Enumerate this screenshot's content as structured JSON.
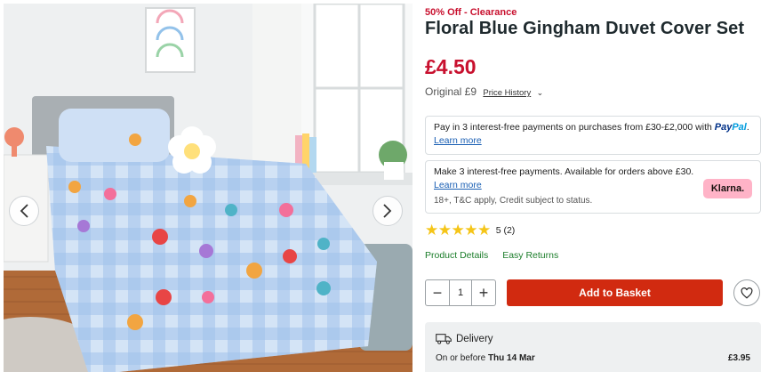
{
  "product": {
    "promo": "50% Off - Clearance",
    "title": "Floral Blue Gingham Duvet Cover Set",
    "price": "£4.50",
    "original_label": "Original £9",
    "price_history_label": "Price History",
    "rating_stars": 5,
    "rating_text": "5 (2)"
  },
  "gallery": {
    "prev_icon": "chevron-left-icon",
    "next_icon": "chevron-right-icon"
  },
  "paypal": {
    "text": "Pay in 3 interest-free payments on purchases from £30-£2,000 with",
    "logo_part1": "Pay",
    "logo_part2": "Pal",
    "logo_suffix": ".",
    "link": "Learn more"
  },
  "klarna": {
    "text": "Make 3 interest-free payments. Available for orders above £30.",
    "link": "Learn more",
    "note": "18+, T&C apply, Credit subject to status.",
    "badge": "Klarna."
  },
  "tabs": {
    "details": "Product Details",
    "returns": "Easy Returns"
  },
  "basket": {
    "minus": "−",
    "qty": "1",
    "plus": "+",
    "add_label": "Add to Basket",
    "wishlist_icon": "heart-icon"
  },
  "delivery": {
    "title": "Delivery",
    "date_prefix": "On or before",
    "date": "Thu 14 Mar",
    "price": "£3.95",
    "icon": "truck-icon"
  },
  "colors": {
    "accent_red": "#c8102e",
    "button_red": "#d12a10",
    "link_blue": "#1a5fb4",
    "link_green": "#1b7d2a",
    "star": "#f5c518",
    "klarna_pink": "#ffb3c7"
  }
}
